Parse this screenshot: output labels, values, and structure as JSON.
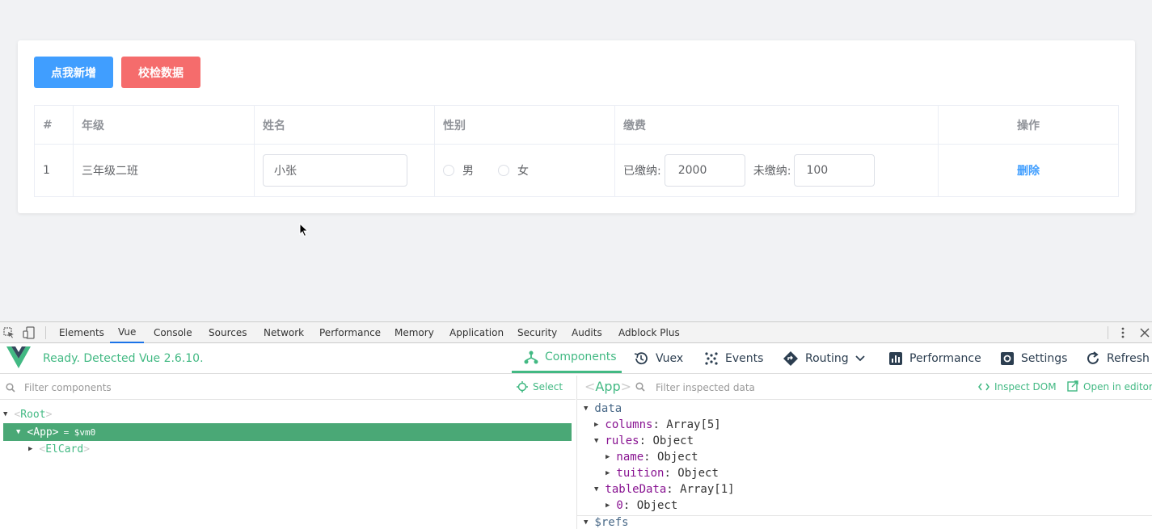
{
  "card": {
    "add_button": "点我新增",
    "validate_button": "校检数据"
  },
  "table": {
    "headers": [
      "#",
      "年级",
      "姓名",
      "性别",
      "缴费",
      "操作"
    ],
    "row": {
      "index": "1",
      "grade": "三年级二班",
      "name_value": "小张",
      "gender_options": [
        "男",
        "女"
      ],
      "paid_label": "已缴纳:",
      "paid_value": "2000",
      "unpaid_label": "未缴纳:",
      "unpaid_value": "100",
      "action": "删除"
    }
  },
  "devtools": {
    "tabs": [
      "Elements",
      "Vue",
      "Console",
      "Sources",
      "Network",
      "Performance",
      "Memory",
      "Application",
      "Security",
      "Audits",
      "Adblock Plus"
    ],
    "active_tab": "Vue"
  },
  "vue": {
    "status": "Ready. Detected Vue 2.6.10.",
    "tabs": {
      "components": "Components",
      "vuex": "Vuex",
      "events": "Events",
      "routing": "Routing",
      "performance": "Performance",
      "settings": "Settings",
      "refresh": "Refresh"
    },
    "filter_components_placeholder": "Filter components",
    "select_label": "Select",
    "tree": {
      "root": "Root",
      "app": "App",
      "app_suffix": "= $vm0",
      "elcard": "ElCard"
    },
    "inspector": {
      "title": "App",
      "filter_placeholder": "Filter inspected data",
      "inspect_dom": "Inspect DOM",
      "open_in_editor": "Open in editor",
      "section_data": "data",
      "columns_key": "columns",
      "columns_val": "Array[5]",
      "rules_key": "rules",
      "rules_val": "Object",
      "name_key": "name",
      "name_val": "Object",
      "tuition_key": "tuition",
      "tuition_val": "Object",
      "tabledata_key": "tableData",
      "tabledata_val": "Array[1]",
      "zero_key": "0",
      "zero_val": "Object",
      "section_refs": "$refs"
    }
  },
  "colors": {
    "primary": "#409eff",
    "danger": "#f56c6c",
    "vue_green": "#42b983"
  }
}
